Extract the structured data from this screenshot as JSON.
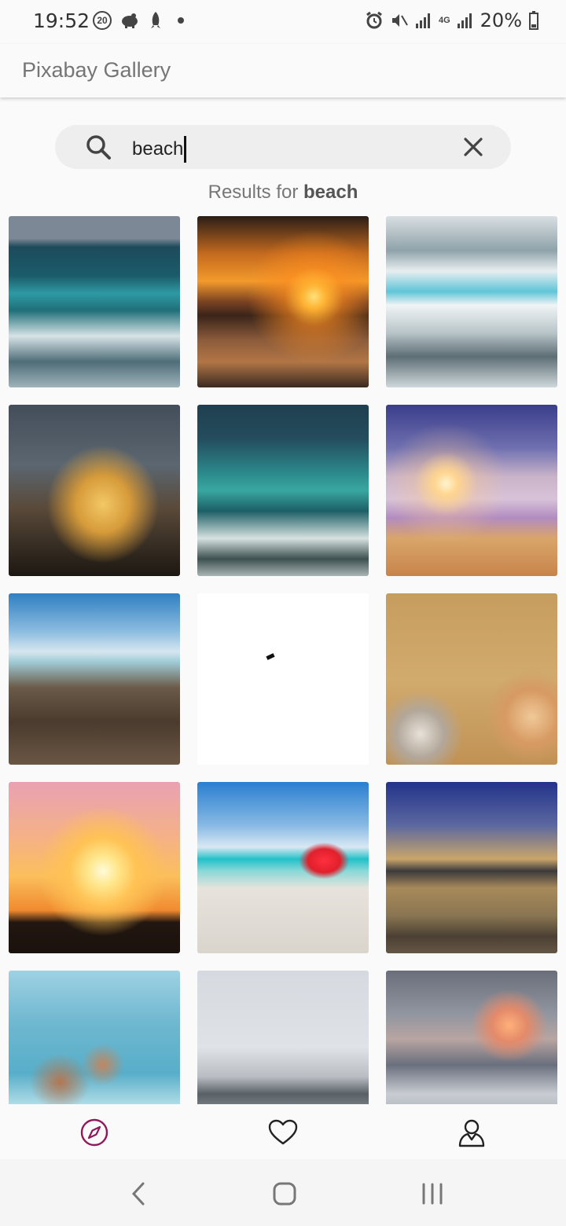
{
  "status": {
    "time": "19:52",
    "notif_badge": "20",
    "net_label": "4G",
    "battery": "20%"
  },
  "appbar": {
    "title": "Pixabay Gallery"
  },
  "search": {
    "value": "beach"
  },
  "results": {
    "prefix": "Results for",
    "term": "beach"
  },
  "images": [
    {
      "name": "sea-waves",
      "bg": "linear-gradient(180deg,#7d8896 0%,#7d8896 13%,#1d4a5c 18%,#1b5c6a 35%,#2e9aa4 45%,#1f6f79 55%,#d7e3e6 70%,#4f6d78 85%,#9fb3ba 100%)"
    },
    {
      "name": "sunset-sea-orange",
      "bg": "radial-gradient(circle at 68% 47%,#ffe07a 0%,#ffb333 8%,rgba(255,140,30,0.6) 20%,rgba(0,0,0,0) 45%),linear-gradient(180deg,#2a1d17 0%,#c46a1e 22%,#f39a2c 38%,#7a4222 50%,#3a2419 58%,#8a5a3a 72%,#b27645 85%,#3a2a22 100%)"
    },
    {
      "name": "wave-crash-white",
      "bg": "linear-gradient(180deg,#d9dfe2 0%,#8fa3aa 20%,#e8eef0 32%,#5fc5d8 44%,#f0f4f5 52%,#b9c5c9 68%,#5d6e74 82%,#cfd8db 100%)"
    },
    {
      "name": "message-bottle",
      "bg": "radial-gradient(ellipse at 55% 58%,#f3c866 0%,#d79b3a 20%,rgba(150,110,60,0.0) 42%),linear-gradient(180deg,#434e5a 0%,#5b6670 35%,#5a4a3a 60%,#3a3025 80%,#1d1812 100%)"
    },
    {
      "name": "teal-wave",
      "bg": "linear-gradient(180deg,#1f3f4f 0%,#244d5e 20%,#2b8a8c 40%,#39a7a0 50%,#1c5f66 62%,#d6e2e0 78%,#3e5050 90%,#a9b5b4 100%)"
    },
    {
      "name": "sunset-beach-purple",
      "bg": "radial-gradient(circle at 35% 46%,#fff4d0 0%,#ffd590 8%,rgba(255,200,140,0.3) 22%,rgba(0,0,0,0) 42%),linear-gradient(180deg,#3a3e8a 0%,#6f6fb0 25%,#c9b3c9 42%,#d7c3d9 55%,#b28cc0 66%,#d9a56a 78%,#c8844a 100%)"
    },
    {
      "name": "pier-wooden",
      "bg": "linear-gradient(180deg,#2f7fc2 0%,#8bbcdf 22%,#d6e6ef 34%,#9fcbd6 40%,#6b5a48 55%,#4a3b2e 75%,#6a5644 100%)"
    },
    {
      "name": "white-blank",
      "bg": "#ffffff"
    },
    {
      "name": "sand-shells-starfish",
      "bg": "radial-gradient(circle at 85% 72%,#f0c998 0%,#d79a63 14%,rgba(0,0,0,0) 24%),radial-gradient(circle at 20% 82%,#e7e1d8 0%,#b2a79a 12%,rgba(0,0,0,0) 22%),linear-gradient(180deg,#c69d5e 0%,#d1aa6d 50%,#c09254 100%)"
    },
    {
      "name": "silhouette-sunset",
      "bg": "radial-gradient(circle at 55% 52%,#fffbd9 0%,#ffe68a 12%,#ffc254 26%,rgba(255,150,60,0) 50%),linear-gradient(180deg,#e9a1b2 0%,#f4b08a 30%,#fbbf5c 55%,#f08a2f 75%,#221610 82%,#1a120d 100%)"
    },
    {
      "name": "red-drink-beach",
      "bg": "radial-gradient(ellipse at 74% 46%,#ff2f3f 0%,#e0202c 9%,rgba(220,40,40,0) 14%),linear-gradient(180deg,#2a7fd0 0%,#86b8e4 25%,#d9e8f3 38%,#23c0c8 45%,#8ad8d8 52%,#e7e3dc 62%,#d9d5cd 100%)"
    },
    {
      "name": "lake-boats-dusk",
      "bg": "linear-gradient(180deg,#23338a 0%,#5a67a0 25%,#c9a56a 45%,#3b3a3c 52%,#a78a5a 62%,#8a7552 78%,#4b4034 90%,#655644 100%)"
    },
    {
      "name": "women-surf",
      "bg": "radial-gradient(ellipse at 30% 65%,#b27752 0%,rgba(180,120,80,0) 18%),radial-gradient(ellipse at 55% 55%,#c08660 0%,rgba(190,130,90,0) 16%),linear-gradient(180deg,#9fd1e3 0%,#6fb8d0 30%,#58aec9 60%,#d2eef3 85%,#8fcfdf 100%)"
    },
    {
      "name": "couple-beach",
      "bg": "linear-gradient(180deg,#d6d9df 0%,#dfe2e6 45%,#b9bdc3 62%,#596066 72%,#8c939a 85%,#b3b9bf 100%)"
    },
    {
      "name": "cloudy-sunset-sea",
      "bg": "radial-gradient(ellipse at 72% 32%,#ffb07a 0%,#e48a6a 10%,rgba(230,140,100,0) 22%),linear-gradient(180deg,#6a6e7a 0%,#9095a0 25%,#b8a5a2 40%,#6a6f7d 55%,#c8ccd2 72%,#8f98a3 100%)"
    }
  ],
  "bottom_nav": [
    {
      "name": "explore",
      "icon": "compass-icon",
      "active": true
    },
    {
      "name": "favorites",
      "icon": "heart-icon",
      "active": false
    },
    {
      "name": "profile",
      "icon": "user-icon",
      "active": false
    }
  ],
  "colors": {
    "accent": "#8e1a5a",
    "search_bg": "#eeeeee"
  }
}
